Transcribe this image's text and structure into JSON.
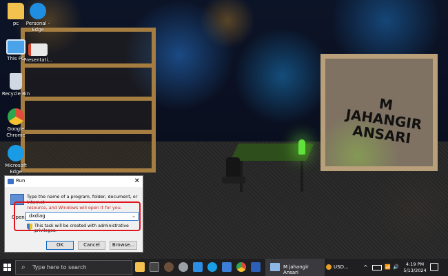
{
  "desktop": {
    "icons": [
      {
        "label": "pc",
        "icon": "folder-icon",
        "color": "#f2c14e"
      },
      {
        "label": "Personal - Edge",
        "icon": "edge-icon",
        "color": "#1f8de0"
      },
      {
        "label": "This PC",
        "icon": "monitor-icon",
        "color": "#4aa3e8"
      },
      {
        "label": "Presentati...",
        "icon": "presentation-icon",
        "color": "#e8e8e8"
      },
      {
        "label": "Recycle Bin",
        "icon": "recycle-bin-icon",
        "color": "#cfd8e3"
      },
      {
        "label": "Google Chrome",
        "icon": "chrome-icon",
        "color": "#e04b3a"
      },
      {
        "label": "Microsoft Edge",
        "icon": "edge-icon",
        "color": "#1a9be6"
      }
    ],
    "wallpaper_sign": "M\nJAHANGIR\nANSARI"
  },
  "run_dialog": {
    "title": "Run",
    "close_glyph": "✕",
    "description_line1": "Type the name of a program, folder, document, or Internet",
    "description_line2": "resource, and Windows will open it for you.",
    "open_label": "Open:",
    "open_value": "dxdiag",
    "admin_note": "This task will be created with administrative privileges.",
    "ok_label": "OK",
    "cancel_label": "Cancel",
    "browse_label": "Browse...",
    "highlight_color": "#e0161e"
  },
  "taskbar": {
    "search_placeholder": "Type here to search",
    "active_window": "M jahangir Ansari",
    "ticker": "USD...",
    "tray_up": "^",
    "tray_volume": "🔊",
    "time": "4:19 PM",
    "date": "5/13/2024",
    "apps": [
      {
        "icon": "file-explorer-icon",
        "color": "#f2c14e"
      },
      {
        "icon": "task-view-icon",
        "color": "#444444"
      },
      {
        "icon": "settings-icon",
        "color": "#9aa0a6"
      },
      {
        "icon": "vscode-icon",
        "color": "#2b8de3"
      },
      {
        "icon": "edge-icon",
        "color": "#18a0e6"
      },
      {
        "icon": "store-icon",
        "color": "#3b7ed8"
      },
      {
        "icon": "chrome-icon",
        "color": "#e04b3a"
      },
      {
        "icon": "word-icon",
        "color": "#2b5fb8"
      }
    ]
  }
}
